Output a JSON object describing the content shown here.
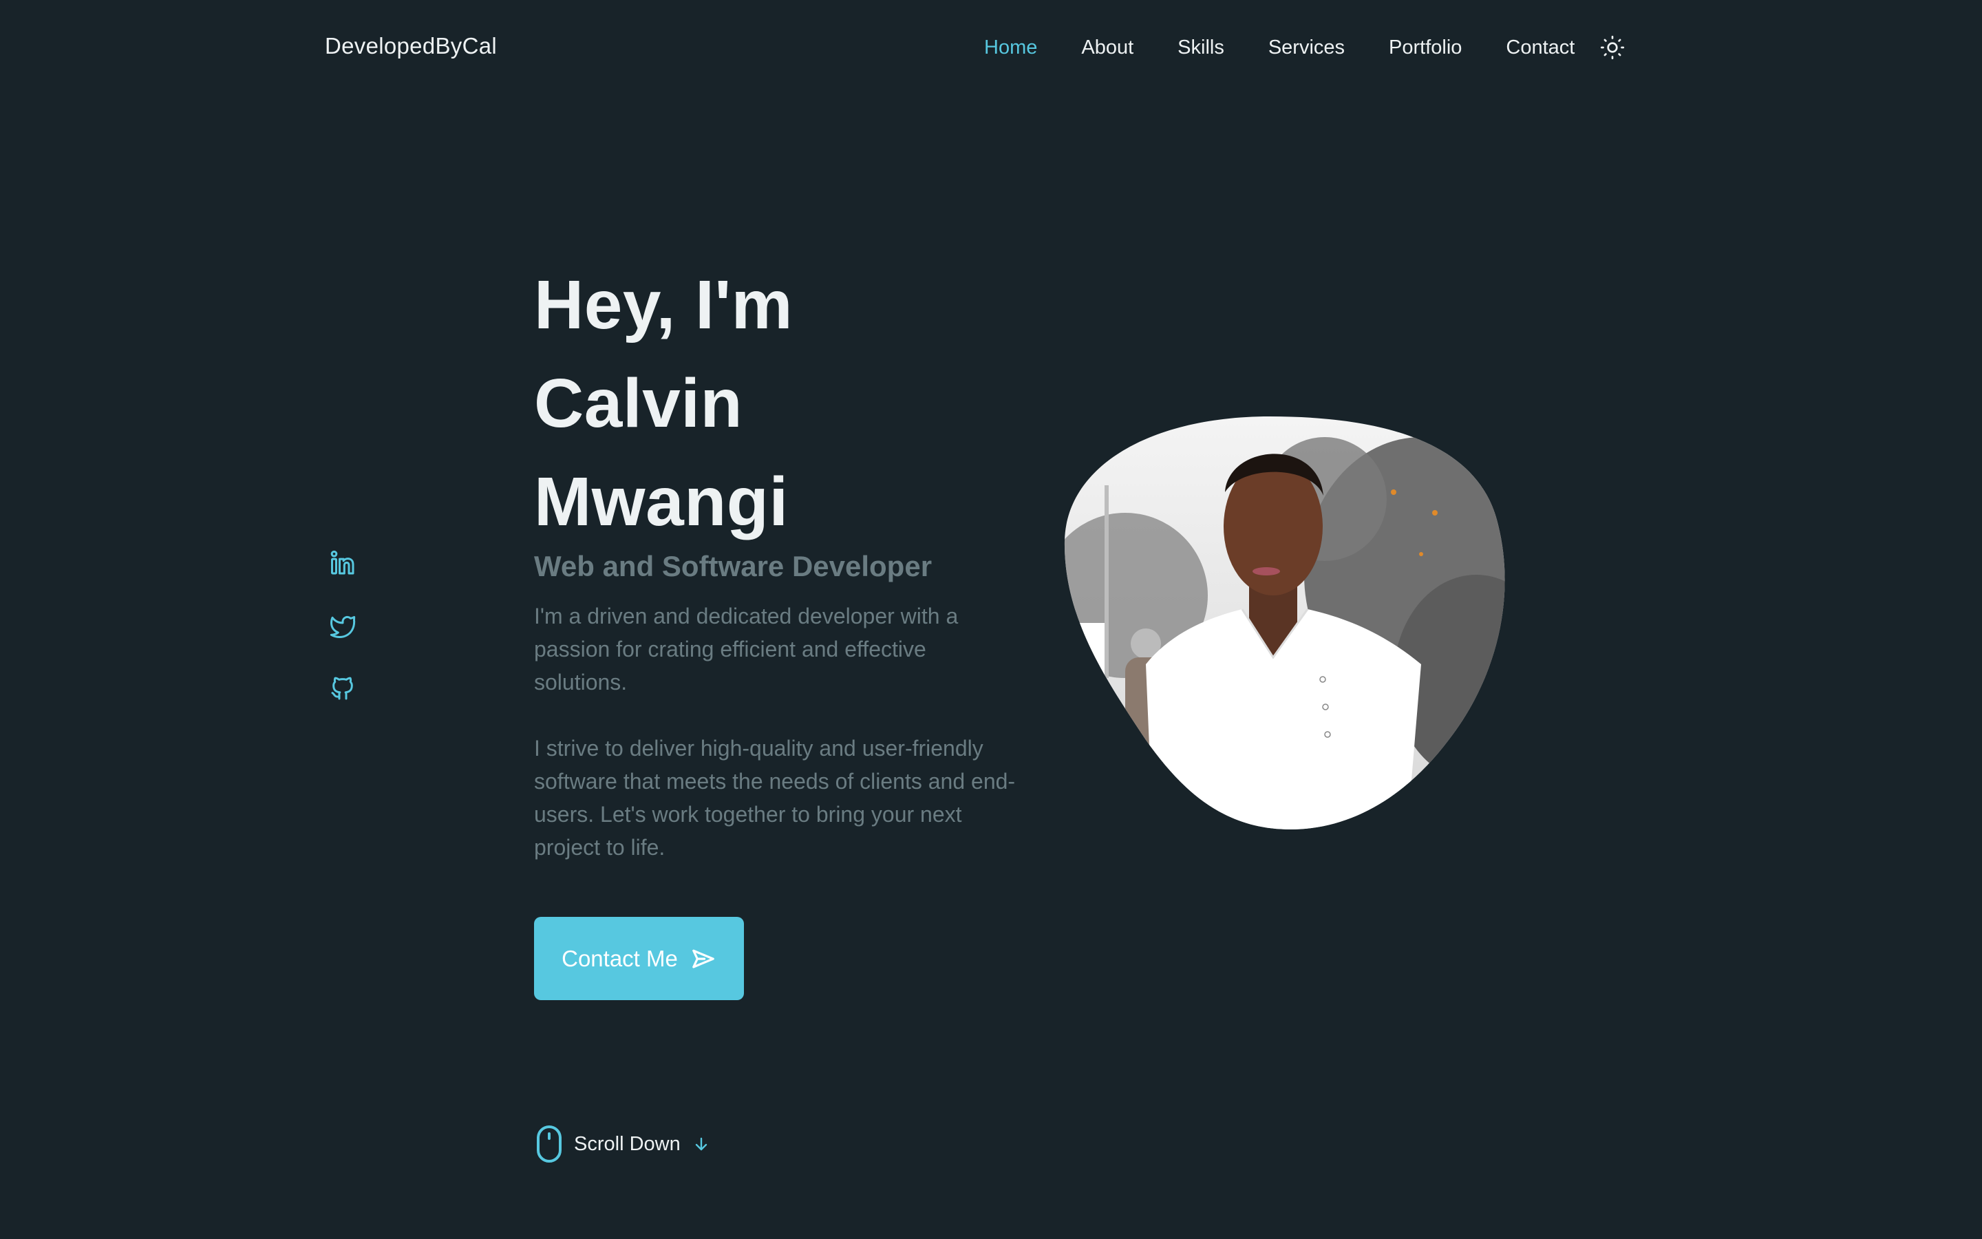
{
  "header": {
    "logo": "DevelopedByCal",
    "nav": [
      {
        "label": "Home",
        "active": true
      },
      {
        "label": "About"
      },
      {
        "label": "Skills"
      },
      {
        "label": "Services"
      },
      {
        "label": "Portfolio"
      },
      {
        "label": "Contact"
      }
    ],
    "theme_icon": "sun-icon"
  },
  "social": [
    {
      "icon": "linkedin-icon"
    },
    {
      "icon": "twitter-icon"
    },
    {
      "icon": "github-icon"
    }
  ],
  "hero": {
    "title_lines": [
      "Hey, I'm",
      "Calvin",
      "Mwangi"
    ],
    "subtitle": "Web and Software Developer",
    "paragraphs": [
      "I'm a driven and dedicated developer with a passion for crating efficient and effective solutions.",
      "I strive to deliver high-quality and user-friendly software that meets the needs of clients and end-users. Let's work together to bring your next project to life."
    ],
    "cta": {
      "label": "Contact Me",
      "icon": "send-icon"
    },
    "scroll": {
      "label": "Scroll Down",
      "icon": "mouse-icon",
      "arrow_icon": "arrow-down-icon"
    },
    "portrait": {
      "description": "Portrait photo of Calvin Mwangi in white polo shirt, blob-shaped frame"
    }
  },
  "colors": {
    "background": "#182329",
    "accent": "#57c8e0",
    "text": "#eef2f3",
    "muted": "#6a7c82"
  }
}
